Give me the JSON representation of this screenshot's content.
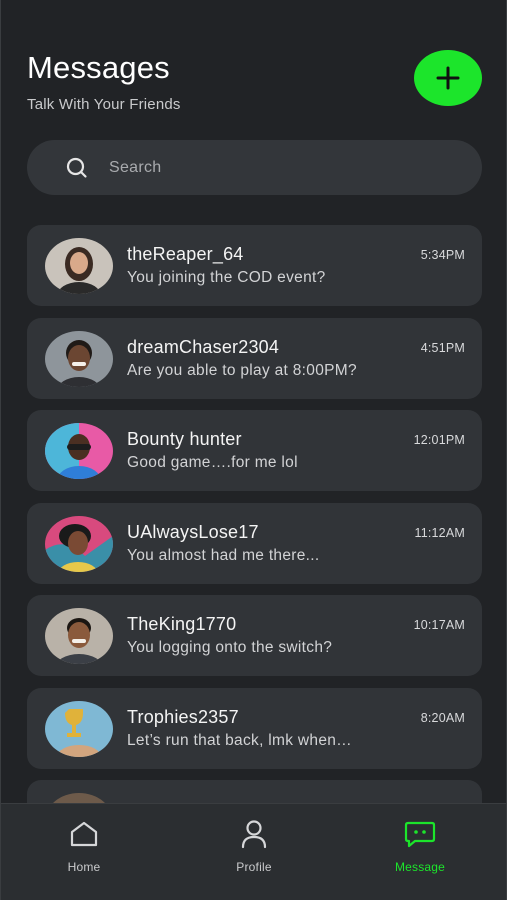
{
  "header": {
    "title": "Messages",
    "subtitle": "Talk With Your Friends"
  },
  "colors": {
    "accent": "#1ce52b",
    "background": "#212326",
    "card": "#313438"
  },
  "search": {
    "placeholder": "Search"
  },
  "conversations": [
    {
      "name": "theReaper_64",
      "message": "You joining the COD event?",
      "time": "5:34PM"
    },
    {
      "name": "dreamChaser2304",
      "message": "Are you able to play at 8:00PM?",
      "time": "4:51PM"
    },
    {
      "name": "Bounty hunter",
      "message": "Good game….for me lol",
      "time": "12:01PM"
    },
    {
      "name": "UAlwaysLose17",
      "message": "You almost had me there...",
      "time": "11:12AM"
    },
    {
      "name": "TheKing1770",
      "message": "You logging onto the switch?",
      "time": "10:17AM"
    },
    {
      "name": "Trophies2357",
      "message": "Let’s run that back, lmk when…",
      "time": "8:20AM"
    }
  ],
  "nav": {
    "home": {
      "label": "Home",
      "icon": "home-icon"
    },
    "profile": {
      "label": "Profile",
      "icon": "person-icon"
    },
    "message": {
      "label": "Message",
      "icon": "chat-icon",
      "active": true
    }
  }
}
